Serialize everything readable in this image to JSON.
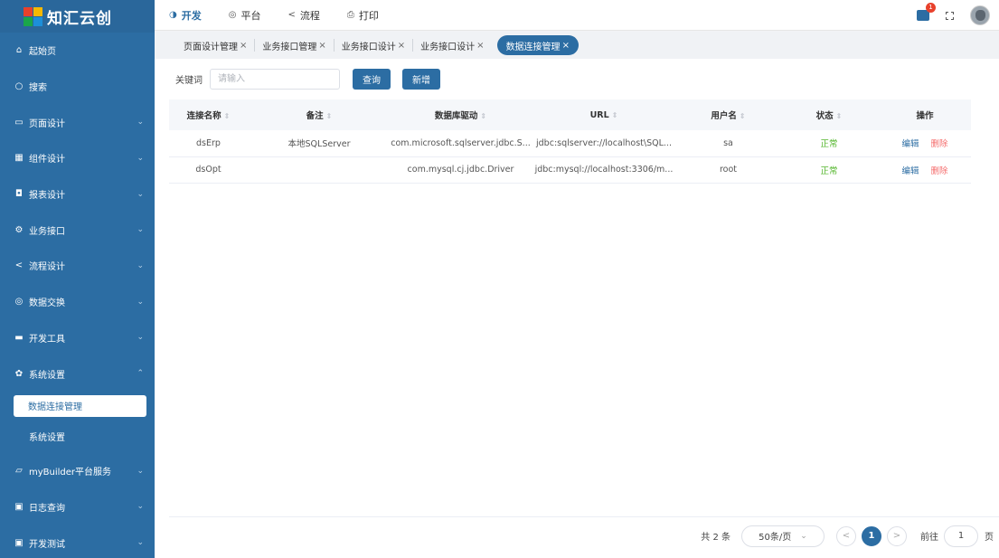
{
  "app": {
    "title": "知汇云创"
  },
  "sidebar": {
    "items": [
      {
        "icon": "⌂",
        "label": "起始页",
        "arrow": ""
      },
      {
        "icon": "○",
        "label": "搜索",
        "arrow": ""
      },
      {
        "icon": "▭",
        "label": "页面设计",
        "arrow": "⌄"
      },
      {
        "icon": "▦",
        "label": "组件设计",
        "arrow": "⌄"
      },
      {
        "icon": "◘",
        "label": "报表设计",
        "arrow": "⌄"
      },
      {
        "icon": "⚙",
        "label": "业务接口",
        "arrow": "⌄"
      },
      {
        "icon": "<",
        "label": "流程设计",
        "arrow": "⌄"
      },
      {
        "icon": "◎",
        "label": "数据交换",
        "arrow": "⌄"
      },
      {
        "icon": "▬",
        "label": "开发工具",
        "arrow": "⌄"
      },
      {
        "icon": "✿",
        "label": "系统设置",
        "arrow": "⌃"
      }
    ],
    "sub_items": [
      {
        "label": "数据连接管理"
      },
      {
        "label": "系统设置"
      }
    ],
    "bottom_items": [
      {
        "icon": "▱",
        "label": "myBuilder平台服务",
        "arrow": "⌄"
      },
      {
        "icon": "▣",
        "label": "日志查询",
        "arrow": "⌄"
      },
      {
        "icon": "▣",
        "label": "开发测试",
        "arrow": "⌄"
      }
    ]
  },
  "topnav": {
    "links": [
      {
        "icon": "◑",
        "label": "开发"
      },
      {
        "icon": "◎",
        "label": "平台"
      },
      {
        "icon": "<",
        "label": "流程"
      },
      {
        "icon": "⎙",
        "label": "打印"
      }
    ],
    "badge_count": "1"
  },
  "tabs": [
    {
      "label": "页面设计管理",
      "close": "×"
    },
    {
      "label": "业务接口管理",
      "close": "×"
    },
    {
      "label": "业务接口设计",
      "close": "×"
    },
    {
      "label": "业务接口设计",
      "close": "×"
    },
    {
      "label": "数据连接管理",
      "close": "×"
    }
  ],
  "search": {
    "label": "关键词",
    "placeholder": "请输入",
    "query_button": "查询",
    "add_button": "新增"
  },
  "table": {
    "columns": [
      "连接名称",
      "备注",
      "数据库驱动",
      "URL",
      "用户名",
      "状态",
      "操作"
    ],
    "rows": [
      {
        "name": "dsErp",
        "remark": "本地SQLServer",
        "driver": "com.microsoft.sqlserver.jdbc.S...",
        "url": "jdbc:sqlserver://localhost\\SQL...",
        "user": "sa",
        "status": "正常",
        "edit": "编辑",
        "delete": "删除"
      },
      {
        "name": "dsOpt",
        "remark": "",
        "driver": "com.mysql.cj.jdbc.Driver",
        "url": "jdbc:mysql://localhost:3306/m...",
        "user": "root",
        "status": "正常",
        "edit": "编辑",
        "delete": "删除"
      }
    ],
    "sort_glyph": "⇕"
  },
  "pager": {
    "total": "共 2 条",
    "page_size": "50条/页",
    "prev": "<",
    "current_page": "1",
    "next": ">",
    "goto_label": "前往",
    "goto_value": "1",
    "page_suffix": "页"
  },
  "colors": {
    "primary": "#2c6da3",
    "status_ok": "#52b52a",
    "danger": "#f56c6c",
    "badge": "#e8412c"
  }
}
